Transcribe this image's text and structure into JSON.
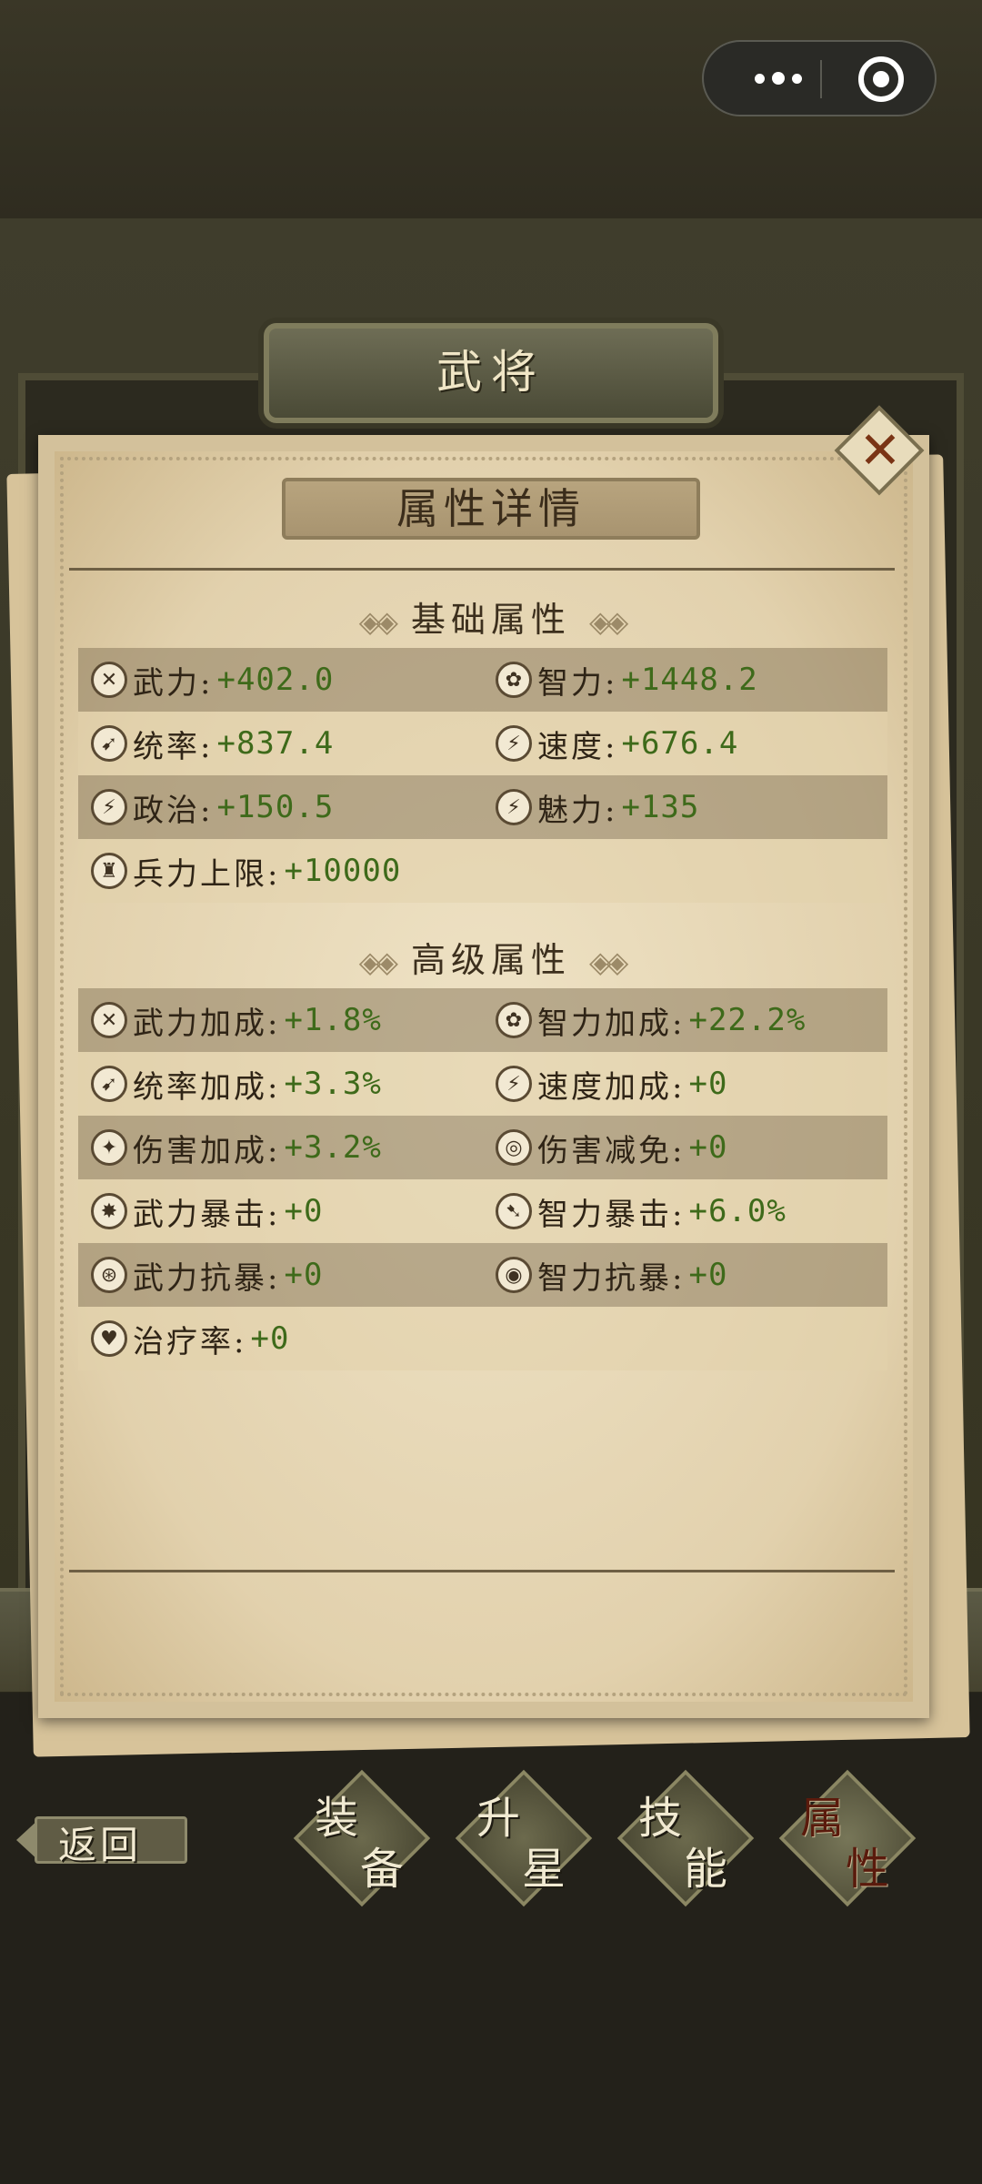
{
  "window_title": "武将",
  "dialog_title": "属性详情",
  "colors": {
    "value_green": "#3e6a1a",
    "paper": "#e9dcbb",
    "frame": "#3f3d2c"
  },
  "basic": {
    "title": "基础属性",
    "rows": [
      {
        "l_icon": "✕",
        "l_label": "武力:",
        "l_value": "+402.0",
        "r_icon": "✿",
        "r_label": "智力:",
        "r_value": "+1448.2"
      },
      {
        "l_icon": "➹",
        "l_label": "统率:",
        "l_value": "+837.4",
        "r_icon": "⚡",
        "r_label": "速度:",
        "r_value": "+676.4"
      },
      {
        "l_icon": "⚡",
        "l_label": "政治:",
        "l_value": "+150.5",
        "r_icon": "⚡",
        "r_label": "魅力:",
        "r_value": "+135"
      },
      {
        "l_icon": "♜",
        "l_label": "兵力上限:",
        "l_value": "+10000"
      }
    ]
  },
  "advanced": {
    "title": "高级属性",
    "rows": [
      {
        "l_icon": "✕",
        "l_label": "武力加成:",
        "l_value": "+1.8%",
        "r_icon": "✿",
        "r_label": "智力加成:",
        "r_value": "+22.2%"
      },
      {
        "l_icon": "➹",
        "l_label": "统率加成:",
        "l_value": "+3.3%",
        "r_icon": "⚡",
        "r_label": "速度加成:",
        "r_value": "+0"
      },
      {
        "l_icon": "✦",
        "l_label": "伤害加成:",
        "l_value": "+3.2%",
        "r_icon": "◎",
        "r_label": "伤害减免:",
        "r_value": "+0"
      },
      {
        "l_icon": "✸",
        "l_label": "武力暴击:",
        "l_value": "+0",
        "r_icon": "➷",
        "r_label": "智力暴击:",
        "r_value": "+6.0%"
      },
      {
        "l_icon": "⊛",
        "l_label": "武力抗暴:",
        "l_value": "+0",
        "r_icon": "◉",
        "r_label": "智力抗暴:",
        "r_value": "+0"
      },
      {
        "l_icon": "♥",
        "l_label": "治疗率:",
        "l_value": "+0"
      }
    ]
  },
  "close_label": "✕",
  "back_label": "返回",
  "tabs": [
    {
      "c1": "装",
      "c2": "备"
    },
    {
      "c1": "升",
      "c2": "星"
    },
    {
      "c1": "技",
      "c2": "能"
    },
    {
      "c1": "属",
      "c2": "性"
    }
  ]
}
